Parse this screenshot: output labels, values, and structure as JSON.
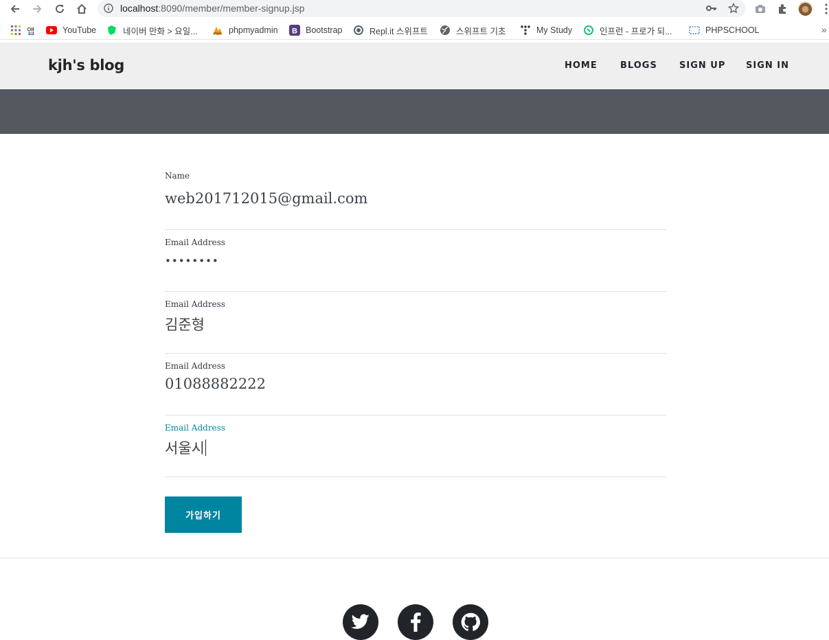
{
  "browser": {
    "url_host": "localhost",
    "url_path": ":8090/member/member-signup.jsp",
    "bookmarks": [
      {
        "label": "앱",
        "icon": "apps-grid-icon"
      },
      {
        "label": "YouTube",
        "icon": "youtube-icon"
      },
      {
        "label": "네이버 만화 > 요일...",
        "icon": "naver-webtoon-icon"
      },
      {
        "label": "phpmyadmin",
        "icon": "phpmyadmin-icon"
      },
      {
        "label": "Bootstrap",
        "icon": "bootstrap-icon"
      },
      {
        "label": "Repl.it 스위프트",
        "icon": "replit-icon"
      },
      {
        "label": "스위프트 기초",
        "icon": "globe-icon"
      },
      {
        "label": "My Study",
        "icon": "dots-icon"
      },
      {
        "label": "인프런 - 프로가 되...",
        "icon": "inflearn-icon"
      },
      {
        "label": "PHPSCHOOL",
        "icon": "phpschool-icon"
      }
    ],
    "more_label": "»"
  },
  "site": {
    "brand": "kjh's blog",
    "menu": [
      "HOME",
      "BLOGS",
      "SIGN UP",
      "SIGN IN"
    ]
  },
  "form": {
    "fields": [
      {
        "label": "Name",
        "value": "web201712015@gmail.com"
      },
      {
        "label": "Email Address",
        "value": "••••••••"
      },
      {
        "label": "Email Address",
        "value": "김준형"
      },
      {
        "label": "Email Address",
        "value": "01088882222"
      },
      {
        "label": "Email Address",
        "value": "서울시"
      }
    ],
    "submit_label": "가입하기"
  },
  "footer": {
    "social": [
      "twitter-icon",
      "facebook-icon",
      "github-icon"
    ]
  },
  "colors": {
    "accent": "#0085a1",
    "masthead": "#545960",
    "nav_bg": "#efefef"
  }
}
